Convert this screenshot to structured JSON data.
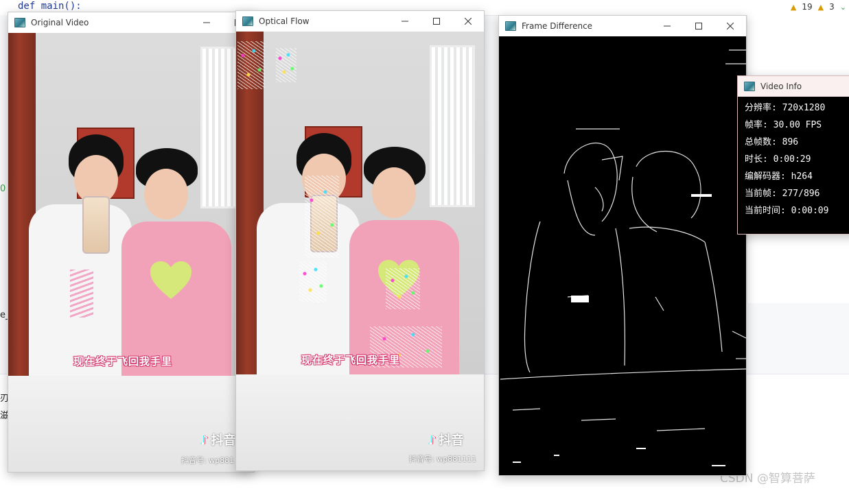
{
  "ide": {
    "code_line": "def main():",
    "warnings_count": "19",
    "weak_warnings_count": "3",
    "fragments": [
      "0",
      "e_",
      "刃约",
      "滋留"
    ]
  },
  "watermark": "CSDN @智算菩萨",
  "windows": {
    "original": {
      "title": "Original Video"
    },
    "optical_flow": {
      "title": "Optical Flow"
    },
    "frame_difference": {
      "title": "Frame Difference"
    },
    "video_info": {
      "title": "Video Info"
    }
  },
  "video": {
    "subtitle": "现在终于飞回我手里",
    "tiktok_brand": "抖音",
    "tiktok_brand_cropped": "抖音",
    "tiktok_id": "抖音号: wp881111",
    "tiktok_id_cropped": "抖音号: wp881"
  },
  "video_info": {
    "lines": [
      "分辨率: 720x1280",
      "帧率: 30.00 FPS",
      "总帧数: 896",
      "时长: 0:00:29",
      "编解码器: h264",
      "当前帧: 277/896",
      "当前时间: 0:00:09"
    ]
  },
  "colors": {
    "accent_pink": "#d6336c",
    "warning": "#d89b00",
    "ok": "#3aa24b"
  },
  "icons": {
    "window_app": "opencv-window-icon",
    "minimize": "minimize-icon",
    "maximize": "maximize-icon",
    "close": "close-icon"
  }
}
